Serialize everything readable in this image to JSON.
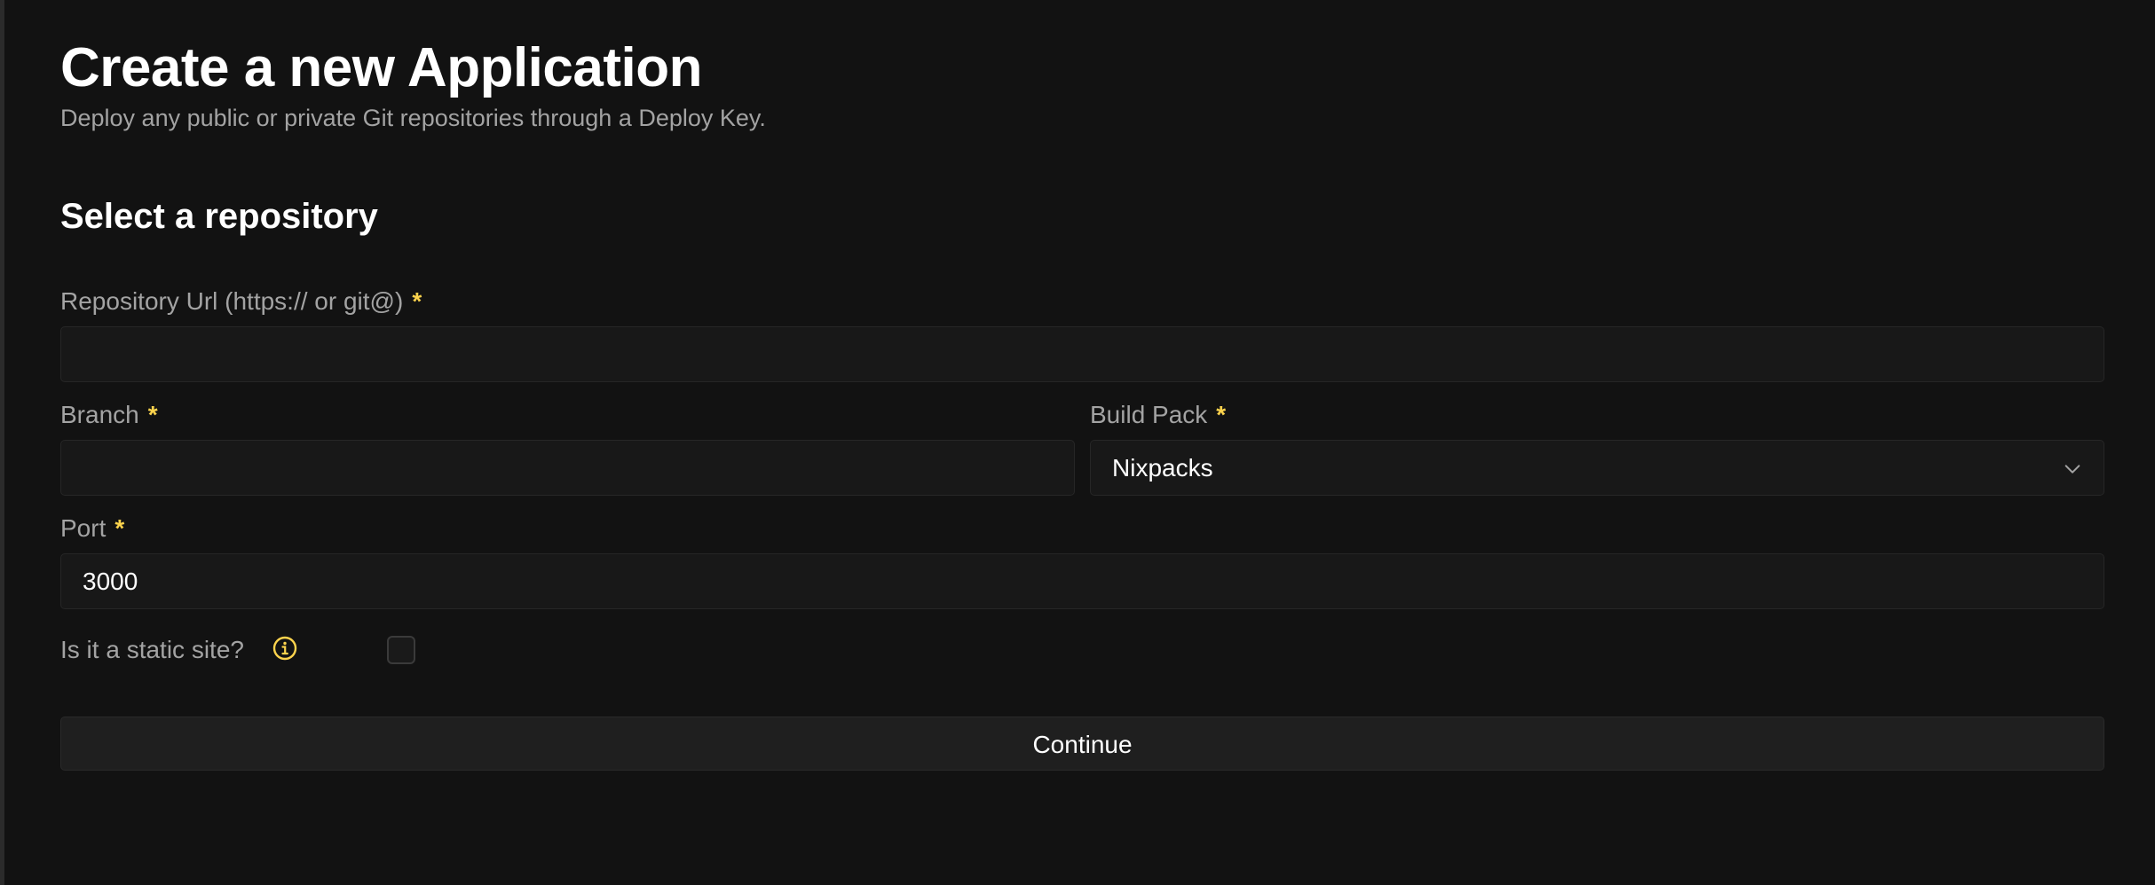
{
  "header": {
    "title": "Create a new Application",
    "subtitle": "Deploy any public or private Git repositories through a Deploy Key."
  },
  "section": {
    "title": "Select a repository"
  },
  "form": {
    "repository_url": {
      "label": "Repository Url (https:// or git@)",
      "required_mark": "*",
      "value": ""
    },
    "branch": {
      "label": "Branch",
      "required_mark": "*",
      "value": ""
    },
    "build_pack": {
      "label": "Build Pack",
      "required_mark": "*",
      "selected": "Nixpacks",
      "icon": "chevron-down-icon"
    },
    "port": {
      "label": "Port",
      "required_mark": "*",
      "value": "3000"
    },
    "static_site": {
      "label": "Is it a static site?",
      "icon": "info-icon",
      "checked": false
    }
  },
  "actions": {
    "continue_label": "Continue"
  },
  "colors": {
    "background": "#121212",
    "input_bg": "#181818",
    "border": "#262626",
    "required": "#fcd34d",
    "muted_text": "#a3a3a3"
  }
}
